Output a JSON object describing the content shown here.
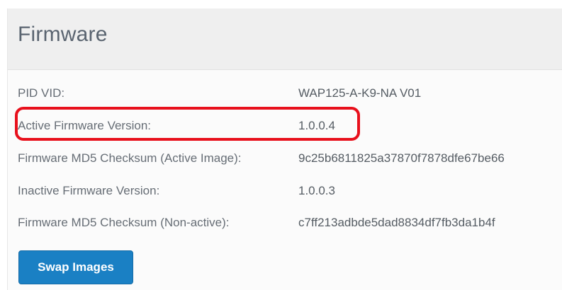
{
  "panel": {
    "title": "Firmware"
  },
  "rows": [
    {
      "label": "PID VID:",
      "value": "WAP125-A-K9-NA V01"
    },
    {
      "label": "Active Firmware Version:",
      "value": "1.0.0.4"
    },
    {
      "label": "Firmware MD5 Checksum (Active Image):",
      "value": "9c25b6811825a37870f7878dfe67be66"
    },
    {
      "label": "Inactive Firmware Version:",
      "value": "1.0.0.3"
    },
    {
      "label": "Firmware MD5 Checksum (Non-active):",
      "value": "c7ff213adbde5dad8834df7fb3da1b4f"
    }
  ],
  "actions": {
    "swap_label": "Swap Images"
  },
  "colors": {
    "highlight": "#e8101c",
    "button": "#1a80c4",
    "header_bg": "#efefef"
  }
}
